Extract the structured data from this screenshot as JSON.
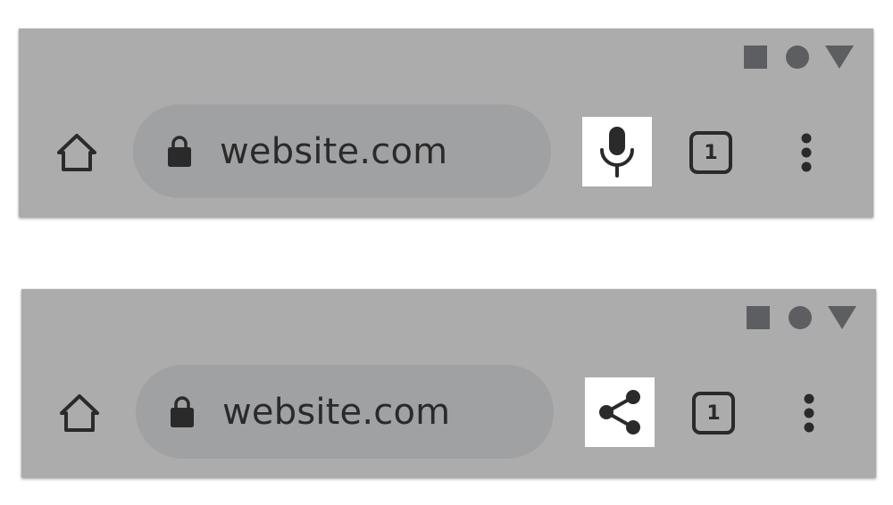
{
  "colors": {
    "toolbar_bg": "#acacac",
    "omnibox_bg": "#a0a1a3",
    "icon_dark": "#2a2a2a",
    "status_icon": "#5d5e61",
    "highlight_bg": "#ffffff"
  },
  "toolbars": [
    {
      "status_icons": [
        "square-icon",
        "circle-icon",
        "triangle-icon"
      ],
      "home_icon": "home-icon",
      "lock_icon": "lock-icon",
      "url": "website.com",
      "action_button": {
        "icon": "microphone-icon",
        "highlighted": true
      },
      "tab_count": "1",
      "menu_icon": "more-vertical-icon"
    },
    {
      "status_icons": [
        "square-icon",
        "circle-icon",
        "triangle-icon"
      ],
      "home_icon": "home-icon",
      "lock_icon": "lock-icon",
      "url": "website.com",
      "action_button": {
        "icon": "share-icon",
        "highlighted": true
      },
      "tab_count": "1",
      "menu_icon": "more-vertical-icon"
    }
  ]
}
